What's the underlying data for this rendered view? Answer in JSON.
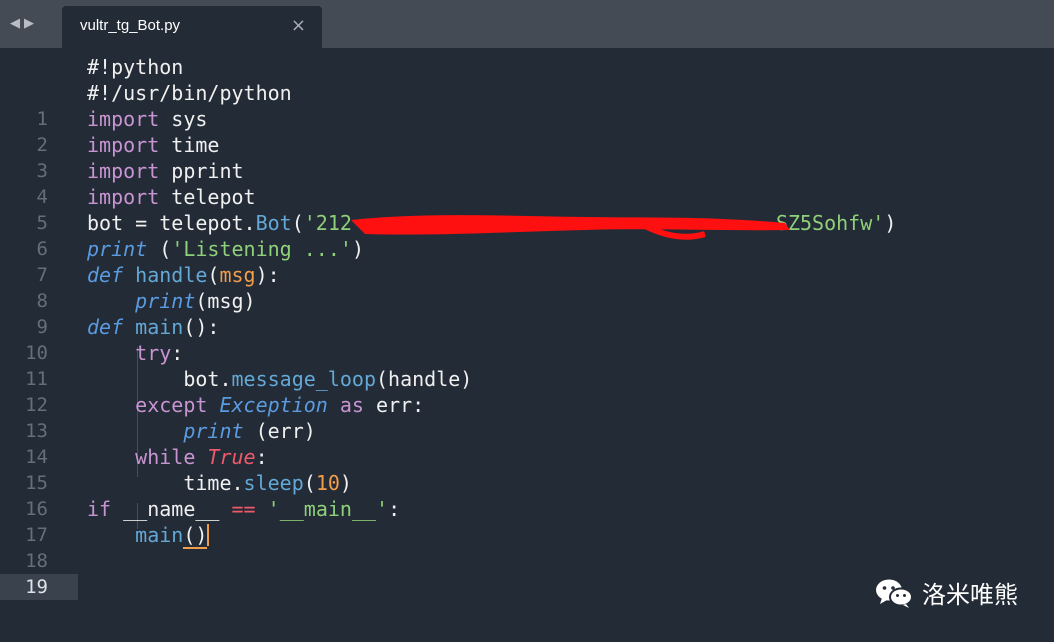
{
  "tabbar": {
    "back_icon": "triangle-left",
    "forward_icon": "triangle-right",
    "tab_title": "vultr_tg_Bot.py",
    "close_label": "×"
  },
  "editor": {
    "current_line": 19,
    "lines": [
      {
        "n": "1"
      },
      {
        "n": "2"
      },
      {
        "n": "3"
      },
      {
        "n": "4"
      },
      {
        "n": "5"
      },
      {
        "n": "6"
      },
      {
        "n": "7"
      },
      {
        "n": "8"
      },
      {
        "n": "9"
      },
      {
        "n": "10"
      },
      {
        "n": "11"
      },
      {
        "n": "12"
      },
      {
        "n": "13"
      },
      {
        "n": "14"
      },
      {
        "n": "15"
      },
      {
        "n": "16"
      },
      {
        "n": "17"
      },
      {
        "n": "18"
      },
      {
        "n": "19"
      }
    ],
    "code": {
      "l1": "#!python",
      "l2": "#!/usr/bin/python",
      "import": "import",
      "sys": "sys",
      "time": "time",
      "pprint": "pprint",
      "telepot": "telepot",
      "l7_bot": "bot",
      "l7_eq": "=",
      "l7_telepot": "telepot.",
      "l7_Bot": "Bot",
      "l7_open": "(",
      "l7_str_start": "'212",
      "l7_str_end": "SZ5Sohfw'",
      "l7_close": ")",
      "print": "print",
      "l8_open": " (",
      "l8_str": "'Listening ...'",
      "l8_close": ")",
      "def": "def",
      "handle": "handle",
      "l9_open": "(",
      "msg": "msg",
      "l9_close": "):",
      "l10_args": "(msg)",
      "main": "main",
      "l11_rest": "():",
      "try": "try",
      "colon": ":",
      "l13_bot": "bot.",
      "message_loop": "message_loop",
      "l13_args": "(handle)",
      "except": "except",
      "Exception": "Exception",
      "as": "as",
      "err": "err:",
      "l15_args": " (err)",
      "while": "while",
      "True": "True",
      "l17_time": "time.",
      "sleep": "sleep",
      "l17_open": "(",
      "ten": "10",
      "l17_close": ")",
      "if": "if",
      "dunder_name": "__name__",
      "eqeq": "==",
      "dunder_main": "'__main__'",
      "l19_main": "main",
      "l19_paren_open": "(",
      "l19_paren_close": ")"
    }
  },
  "watermark": {
    "icon": "wechat-icon",
    "text": "洛米唯熊"
  },
  "colors": {
    "background": "#232b36",
    "tabbar": "#444b55",
    "keyword": "#c894d2",
    "function": "#63a8d6",
    "string": "#8fd07a",
    "number": "#f29d4a",
    "redaction": "#ff1010"
  }
}
